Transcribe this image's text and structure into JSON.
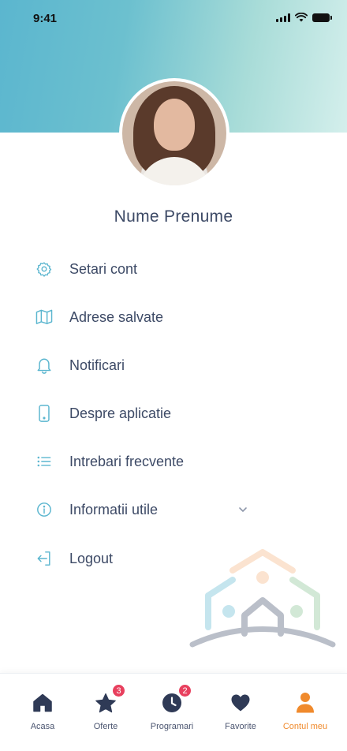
{
  "status_bar": {
    "time": "9:41"
  },
  "profile": {
    "name": "Nume Prenume"
  },
  "menu": [
    {
      "label": "Setari cont",
      "icon": "gear-icon"
    },
    {
      "label": "Adrese salvate",
      "icon": "map-icon"
    },
    {
      "label": "Notificari",
      "icon": "bell-icon"
    },
    {
      "label": "Despre aplicatie",
      "icon": "phone-icon"
    },
    {
      "label": "Intrebari frecvente",
      "icon": "list-icon"
    },
    {
      "label": "Informatii utile",
      "icon": "info-icon",
      "expandable": true
    },
    {
      "label": "Logout",
      "icon": "logout-icon"
    }
  ],
  "bottom_nav": [
    {
      "label": "Acasa",
      "icon": "home-icon",
      "badge": ""
    },
    {
      "label": "Oferte",
      "icon": "star-icon",
      "badge": "3"
    },
    {
      "label": "Programari",
      "icon": "clock-icon",
      "badge": "2"
    },
    {
      "label": "Favorite",
      "icon": "heart-icon",
      "badge": ""
    },
    {
      "label": "Contul meu",
      "icon": "user-icon",
      "badge": "",
      "active": true
    }
  ],
  "colors": {
    "accent": "#5bb6cf",
    "active": "#f08a2c",
    "text": "#3d4a66",
    "badge": "#e8405e",
    "nav_icon": "#2f3a56"
  }
}
